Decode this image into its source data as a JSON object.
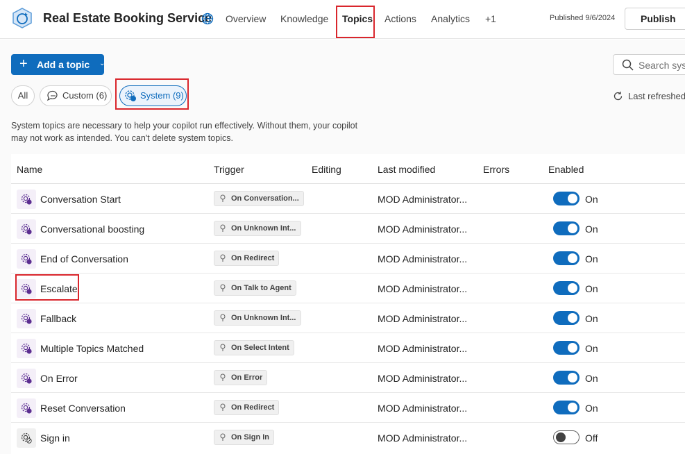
{
  "header": {
    "app_title": "Real Estate Booking Service",
    "nav": [
      "Overview",
      "Knowledge",
      "Topics",
      "Actions",
      "Analytics",
      "+1"
    ],
    "active_nav": "Topics",
    "published": "Published 9/6/2024",
    "publish_label": "Publish"
  },
  "toolbar": {
    "add_topic_label": "Add a topic",
    "search_placeholder": "Search syst",
    "filters": {
      "all": "All",
      "custom": "Custom (6)",
      "system": "System (9)"
    },
    "refresh_label": "Last refreshed"
  },
  "description": "System topics are necessary to help your copilot run effectively. Without them, your copilot may not work as intended. You can't delete system topics.",
  "table": {
    "columns": [
      "Name",
      "Trigger",
      "Editing",
      "Last modified",
      "Errors",
      "Enabled"
    ],
    "rows": [
      {
        "name": "Conversation Start",
        "trigger": "On Conversation...",
        "modified": "MOD Administrator...",
        "enabled": "On"
      },
      {
        "name": "Conversational boosting",
        "trigger": "On Unknown Int...",
        "modified": "MOD Administrator...",
        "enabled": "On"
      },
      {
        "name": "End of Conversation",
        "trigger": "On Redirect",
        "modified": "MOD Administrator...",
        "enabled": "On"
      },
      {
        "name": "Escalate",
        "trigger": "On Talk to Agent",
        "modified": "MOD Administrator...",
        "enabled": "On"
      },
      {
        "name": "Fallback",
        "trigger": "On Unknown Int...",
        "modified": "MOD Administrator...",
        "enabled": "On"
      },
      {
        "name": "Multiple Topics Matched",
        "trigger": "On Select Intent",
        "modified": "MOD Administrator...",
        "enabled": "On"
      },
      {
        "name": "On Error",
        "trigger": "On Error",
        "modified": "MOD Administrator...",
        "enabled": "On"
      },
      {
        "name": "Reset Conversation",
        "trigger": "On Redirect",
        "modified": "MOD Administrator...",
        "enabled": "On"
      },
      {
        "name": "Sign in",
        "trigger": "On Sign In",
        "modified": "MOD Administrator...",
        "enabled": "Off"
      }
    ]
  },
  "colors": {
    "accent": "#0f6cbd",
    "highlight": "#d9262c",
    "topic_icon": "#5c2e91"
  },
  "icons": {
    "app": "copilot-hexagon-icon",
    "globe": "globe-icon",
    "search": "search-icon",
    "custom": "chat-icon",
    "system": "gear-icon",
    "refresh": "refresh-icon",
    "trigger": "lightbulb-icon",
    "row": "system-topic-icon"
  }
}
